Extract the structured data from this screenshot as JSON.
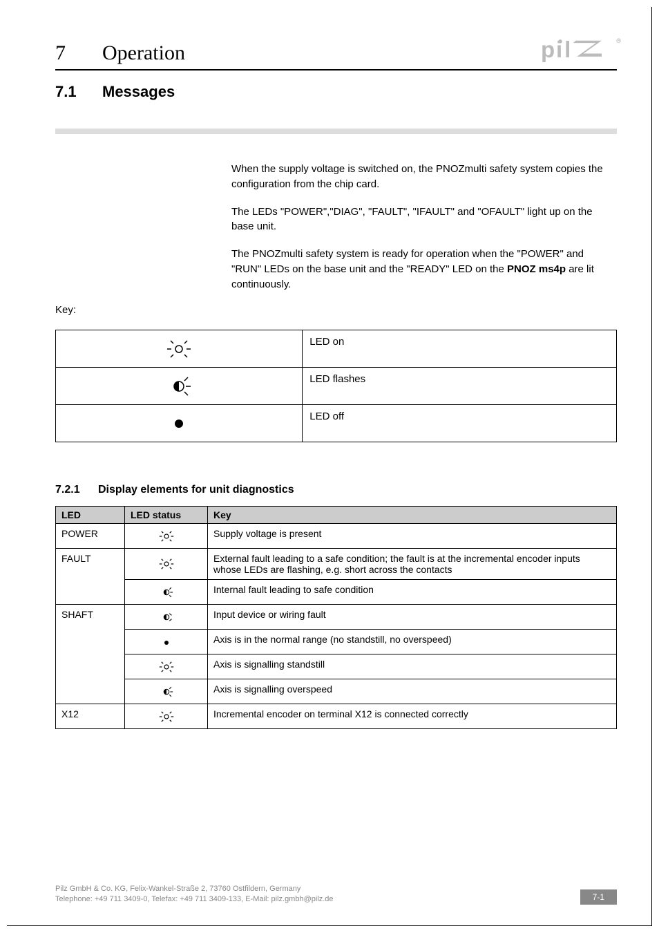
{
  "chapter": {
    "number": "7",
    "title": "Operation"
  },
  "section": {
    "number": "7.1",
    "title": "Messages"
  },
  "paragraphs": {
    "p1": "When the supply voltage is switched on, the PNOZmulti safety system copies the configuration from the chip card.",
    "p2": "The LEDs \"POWER\",\"DIAG\", \"FAULT\", \"IFAULT\" and \"OFAULT\" light up on the base unit.",
    "p3a": "The PNOZmulti safety system is ready for operation when the \"POWER\" and \"RUN\" LEDs on the base unit and the \"READY\" LED on the ",
    "p3b": "PNOZ ms4p",
    "p3c": " are lit continuously."
  },
  "key_label": "Key:",
  "led_legend": {
    "on": "LED on",
    "flashes": "LED flashes",
    "off": "LED off"
  },
  "subsection": {
    "number": "7.2.1",
    "title": "Display elements for unit diagnostics"
  },
  "diag_headers": {
    "led": "LED",
    "status": "LED status",
    "key": "Key"
  },
  "diag_rows": {
    "power": {
      "label": "POWER",
      "desc": "Supply voltage is present"
    },
    "fault": {
      "label": "FAULT",
      "desc1": "External fault leading to a safe condition; the fault is at the incremental encoder inputs whose LEDs are flashing, e.g. short across the contacts",
      "desc2": "Internal fault leading to safe condition"
    },
    "shaft": {
      "label": "SHAFT",
      "desc1": "Input device or wiring fault",
      "desc2": "Axis is in the normal range (no standstill, no overspeed)",
      "desc3": "Axis is signalling standstill",
      "desc4": "Axis is signalling overspeed"
    },
    "x12": {
      "label": "X12",
      "desc": "Incremental encoder on terminal X12 is connected correctly"
    }
  },
  "footer": {
    "line1": "Pilz GmbH & Co. KG, Felix-Wankel-Straße 2, 73760 Ostfildern, Germany",
    "line2": "Telephone: +49 711 3409-0, Telefax: +49 711 3409-133, E-Mail: pilz.gmbh@pilz.de",
    "page": "7-1"
  },
  "logo_text": "pilz"
}
